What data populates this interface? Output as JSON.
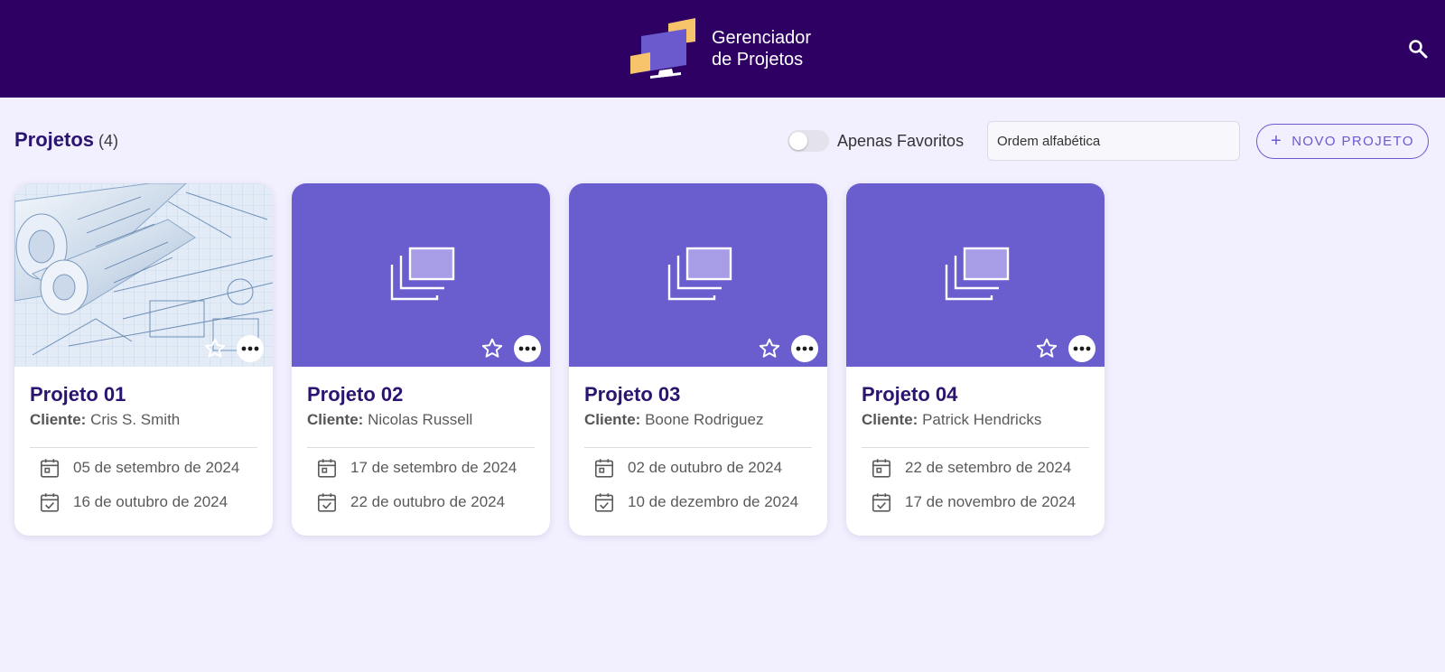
{
  "header": {
    "brand_line1": "Gerenciador",
    "brand_line2": "de Projetos"
  },
  "toolbar": {
    "title": "Projetos",
    "count": "(4)",
    "favorites_label": "Apenas Favoritos",
    "favorites_on": false,
    "sort_value": "Ordem alfabética",
    "new_project_label": "NOVO PROJETO"
  },
  "colors": {
    "header_bg": "#2e0063",
    "accent": "#6a5acd",
    "card_placeholder": "#6a5ecf",
    "title_text": "#2b1470"
  },
  "client_label": "Cliente:",
  "projects": [
    {
      "name": "Projeto 01",
      "client": "Cris S. Smith",
      "start": "05 de setembro de 2024",
      "end": "16 de outubro de 2024",
      "cover": "blueprint-photo",
      "favorite": false
    },
    {
      "name": "Projeto 02",
      "client": "Nicolas Russell",
      "start": "17 de setembro de 2024",
      "end": "22 de outubro de 2024",
      "cover": "placeholder",
      "favorite": false
    },
    {
      "name": "Projeto 03",
      "client": "Boone Rodriguez",
      "start": "02 de outubro de 2024",
      "end": "10 de dezembro de 2024",
      "cover": "placeholder",
      "favorite": false
    },
    {
      "name": "Projeto 04",
      "client": "Patrick Hendricks",
      "start": "22 de setembro de 2024",
      "end": "17 de novembro de 2024",
      "cover": "placeholder",
      "favorite": false
    }
  ]
}
